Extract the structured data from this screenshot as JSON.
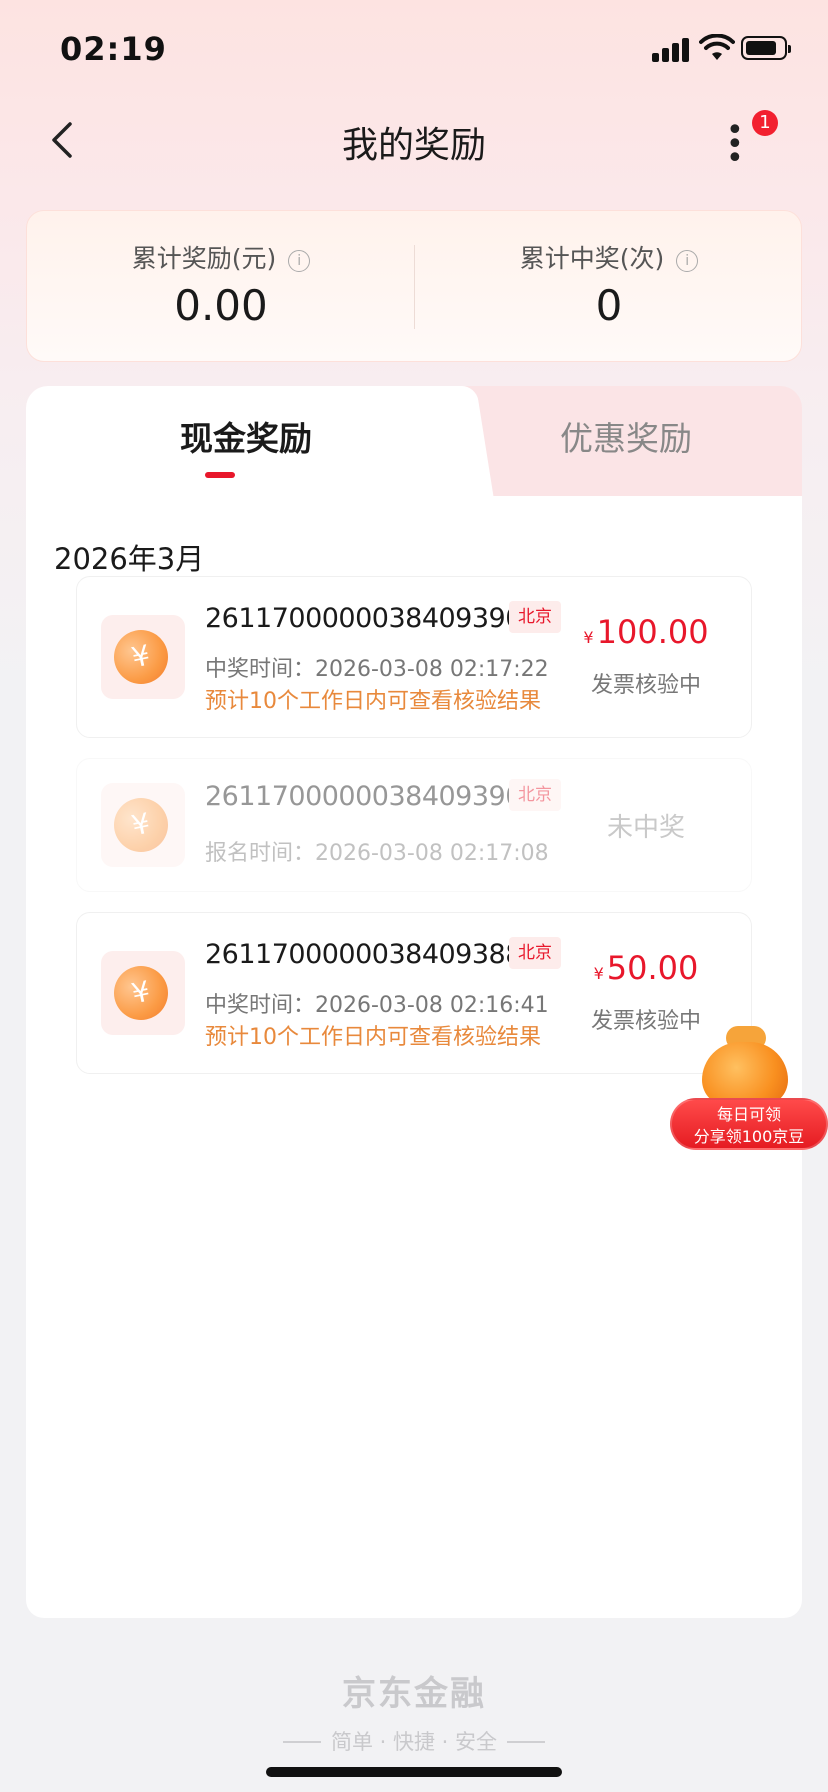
{
  "status_bar": {
    "time": "02:19"
  },
  "header": {
    "title": "我的奖励",
    "more_badge": "1"
  },
  "summary": {
    "total_reward_label": "累计奖励(元)",
    "total_reward_value": "0.00",
    "total_wins_label": "累计中奖(次)",
    "total_wins_value": "0"
  },
  "tabs": [
    {
      "label": "现金奖励"
    },
    {
      "label": "优惠奖励"
    }
  ],
  "month": "2026年3月",
  "records": [
    {
      "id": "26117000000384093904",
      "city": "北京",
      "time_text": "中奖时间：2026-03-08 02:17:22",
      "note": "预计10个工作日内可查看核验结果",
      "currency": "¥",
      "amount": "100.00",
      "status": "发票核验中"
    },
    {
      "id": "26117000000384093905",
      "city": "北京",
      "time_text": "报名时间：2026-03-08 02:17:08",
      "status": "未中奖"
    },
    {
      "id": "26117000000384093883",
      "city": "北京",
      "time_text": "中奖时间：2026-03-08 02:16:41",
      "note": "预计10个工作日内可查看核验结果",
      "currency": "¥",
      "amount": "50.00",
      "status": "发票核验中"
    }
  ],
  "float_promo": {
    "line1": "每日可领",
    "line2": "分享领100京豆"
  },
  "footer": {
    "brand": "京东金融",
    "slogan": "简单 · 快捷 · 安全"
  },
  "colors": {
    "accent": "#e8172b",
    "note": "#e8893c"
  }
}
